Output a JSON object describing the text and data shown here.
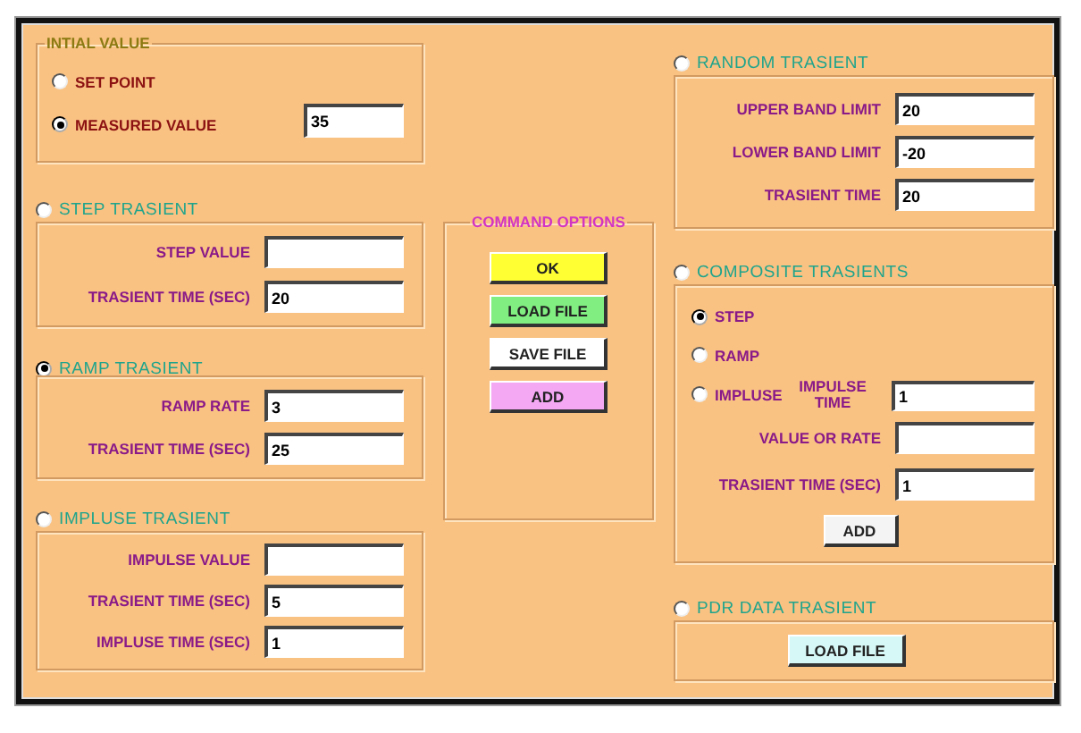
{
  "initial_value": {
    "title": "INTIAL VALUE",
    "options": [
      {
        "label": "SET POINT",
        "selected": false
      },
      {
        "label": "MEASURED VALUE",
        "selected": true
      }
    ],
    "value": "35"
  },
  "step_transient": {
    "label": "STEP TRASIENT",
    "selected": false,
    "fields": [
      {
        "label": "STEP VALUE"
      },
      {
        "label": "TRASIENT TIME (SEC)",
        "value": "20"
      }
    ]
  },
  "ramp_transient": {
    "label": "RAMP TRASIENT",
    "selected": true,
    "fields": [
      {
        "label": "RAMP RATE",
        "value": "3"
      },
      {
        "label": "TRASIENT TIME (SEC)",
        "value": "25"
      }
    ]
  },
  "impulse_transient": {
    "label": "IMPLUSE TRASIENT",
    "selected": false,
    "fields": [
      {
        "label": "IMPULSE VALUE"
      },
      {
        "label": "TRASIENT TIME (SEC)",
        "value": "5"
      },
      {
        "label": "IMPLUSE TIME (SEC)",
        "value": "1"
      }
    ]
  },
  "command_options": {
    "title": "COMMAND OPTIONS",
    "buttons": [
      {
        "label": "OK",
        "color": "#ffff33"
      },
      {
        "label": "LOAD FILE",
        "color": "#80ee80"
      },
      {
        "label": "SAVE FILE",
        "color": "#ffffff"
      },
      {
        "label": "ADD",
        "color": "#f4a8f4"
      }
    ]
  },
  "random_transient": {
    "label": "RANDOM TRASIENT",
    "selected": false,
    "fields": [
      {
        "label": "UPPER BAND LIMIT",
        "value": "20"
      },
      {
        "label": "LOWER BAND LIMIT",
        "value": "-20"
      },
      {
        "label": "TRASIENT TIME",
        "value": "20"
      }
    ]
  },
  "composite_transients": {
    "label": "COMPOSITE TRASIENTS",
    "selected": false,
    "options": [
      {
        "label": "STEP",
        "selected": true
      },
      {
        "label": "RAMP",
        "selected": false
      },
      {
        "label": "IMPLUSE",
        "selected": false
      }
    ],
    "impulse_time": {
      "label": "IMPULSE TIME",
      "value": "1"
    },
    "fields": [
      {
        "label": "VALUE OR RATE"
      },
      {
        "label": "TRASIENT TIME (SEC)",
        "value": "1"
      }
    ],
    "button": "ADD"
  },
  "pdr_data_transient": {
    "label": "PDR DATA TRASIENT",
    "selected": false,
    "button": "LOAD FILE"
  }
}
